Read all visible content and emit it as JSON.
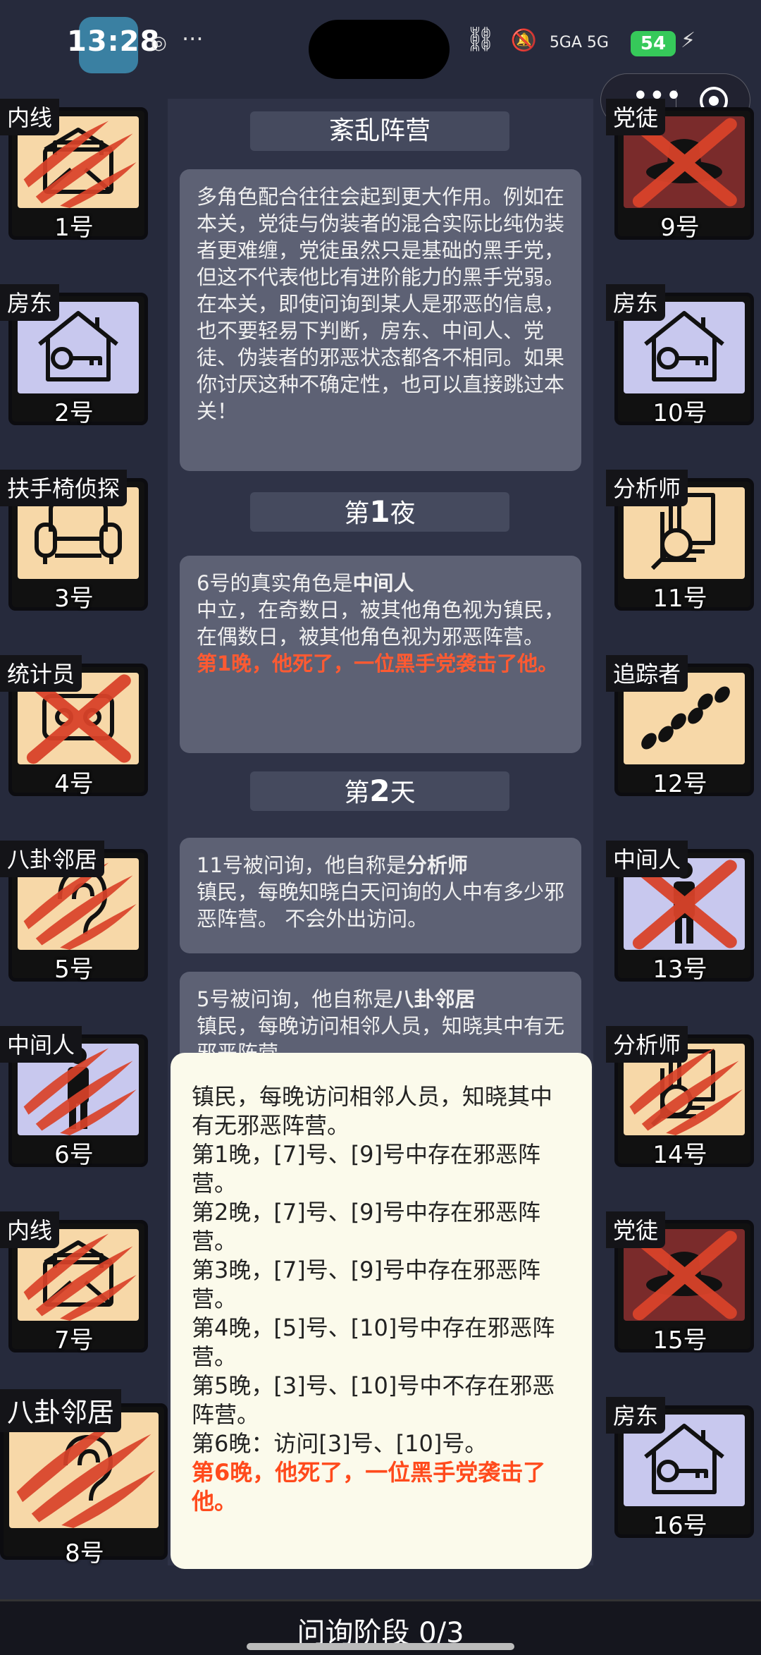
{
  "status_bar": {
    "time": "13:28",
    "network": "5GA 5G",
    "battery": "54"
  },
  "section_titles": [
    "紊乱阵营",
    "第",
    "1",
    "夜",
    "第",
    "2",
    "天"
  ],
  "intro_text": "多角色配合往往会起到更大作用。例如在本关，党徒与伪装者的混合实际比纯伪装者更难缠，党徒虽然只是基础的黑手党，但这不代表他比有进阶能力的黑手党弱。在本关，即使问询到某人是邪恶的信息，也不要轻易下判断，房东、中间人、党徒、伪装者的邪恶状态都各不相同。如果你讨厌这种不确定性，也可以直接跳过本关！",
  "night1": {
    "prefix": "6号的真实角色是",
    "role": "中间人",
    "desc": "中立，在奇数日，被其他角色视为镇民，在偶数日，被其他角色视为邪恶阵营。",
    "death": "第1晚，他死了，一位黑手党袭击了他。"
  },
  "day2_msg1": {
    "prefix": "11号被问询，他自称是",
    "role": "分析师",
    "desc": "镇民，每晚知晓白天问询的人中有多少邪恶阵营。 不会外出访问。"
  },
  "day2_msg2": {
    "prefix": "5号被问询，他自称是",
    "role": "八卦邻居",
    "desc": "镇民，每晚访问相邻人员，知晓其中有无邪恶阵营。"
  },
  "popup": {
    "lines": [
      "镇民，每晚访问相邻人员，知晓其中有无邪恶阵营。",
      "第1晚，[7]号、[9]号中存在邪恶阵营。",
      "第2晚，[7]号、[9]号中存在邪恶阵营。",
      "第3晚，[7]号、[9]号中存在邪恶阵营。",
      "第4晚，[5]号、[10]号中存在邪恶阵营。",
      "第5晚，[3]号、[10]号中不存在邪恶阵营。",
      "第6晚：访问[3]号、[10]号。"
    ],
    "death": "第6晚，他死了，一位黑手党袭击了他。"
  },
  "bottom_label": "问询阶段 0/3",
  "players": [
    {
      "role": "内线",
      "num": "1号",
      "bg": "cream",
      "icon": "envelope-icon",
      "mark": "claw"
    },
    {
      "role": "房东",
      "num": "2号",
      "bg": "lav",
      "icon": "house-key-icon",
      "mark": ""
    },
    {
      "role": "扶手椅侦探",
      "num": "3号",
      "bg": "cream",
      "icon": "armchair-icon",
      "mark": ""
    },
    {
      "role": "统计员",
      "num": "4号",
      "bg": "cream",
      "icon": "abacus-icon",
      "mark": "x"
    },
    {
      "role": "八卦邻居",
      "num": "5号",
      "bg": "cream",
      "icon": "ear-icon",
      "mark": "claw"
    },
    {
      "role": "中间人",
      "num": "6号",
      "bg": "lav",
      "icon": "person-icon",
      "mark": "claw"
    },
    {
      "role": "内线",
      "num": "7号",
      "bg": "cream",
      "icon": "envelope-icon",
      "mark": "claw"
    },
    {
      "role": "八卦邻居",
      "num": "8号",
      "bg": "cream",
      "icon": "ear-icon",
      "mark": "claw"
    },
    {
      "role": "党徒",
      "num": "9号",
      "bg": "red",
      "icon": "hat-icon",
      "mark": "x"
    },
    {
      "role": "房东",
      "num": "10号",
      "bg": "lav",
      "icon": "house-key-icon",
      "mark": ""
    },
    {
      "role": "分析师",
      "num": "11号",
      "bg": "cream",
      "icon": "documents-search-icon",
      "mark": ""
    },
    {
      "role": "追踪者",
      "num": "12号",
      "bg": "cream",
      "icon": "footprints-icon",
      "mark": ""
    },
    {
      "role": "中间人",
      "num": "13号",
      "bg": "lav",
      "icon": "person-icon",
      "mark": "x"
    },
    {
      "role": "分析师",
      "num": "14号",
      "bg": "cream",
      "icon": "documents-search-icon",
      "mark": "claw"
    },
    {
      "role": "党徒",
      "num": "15号",
      "bg": "red",
      "icon": "hat-icon",
      "mark": "x"
    },
    {
      "role": "房东",
      "num": "16号",
      "bg": "lav",
      "icon": "house-key-icon",
      "mark": ""
    }
  ]
}
